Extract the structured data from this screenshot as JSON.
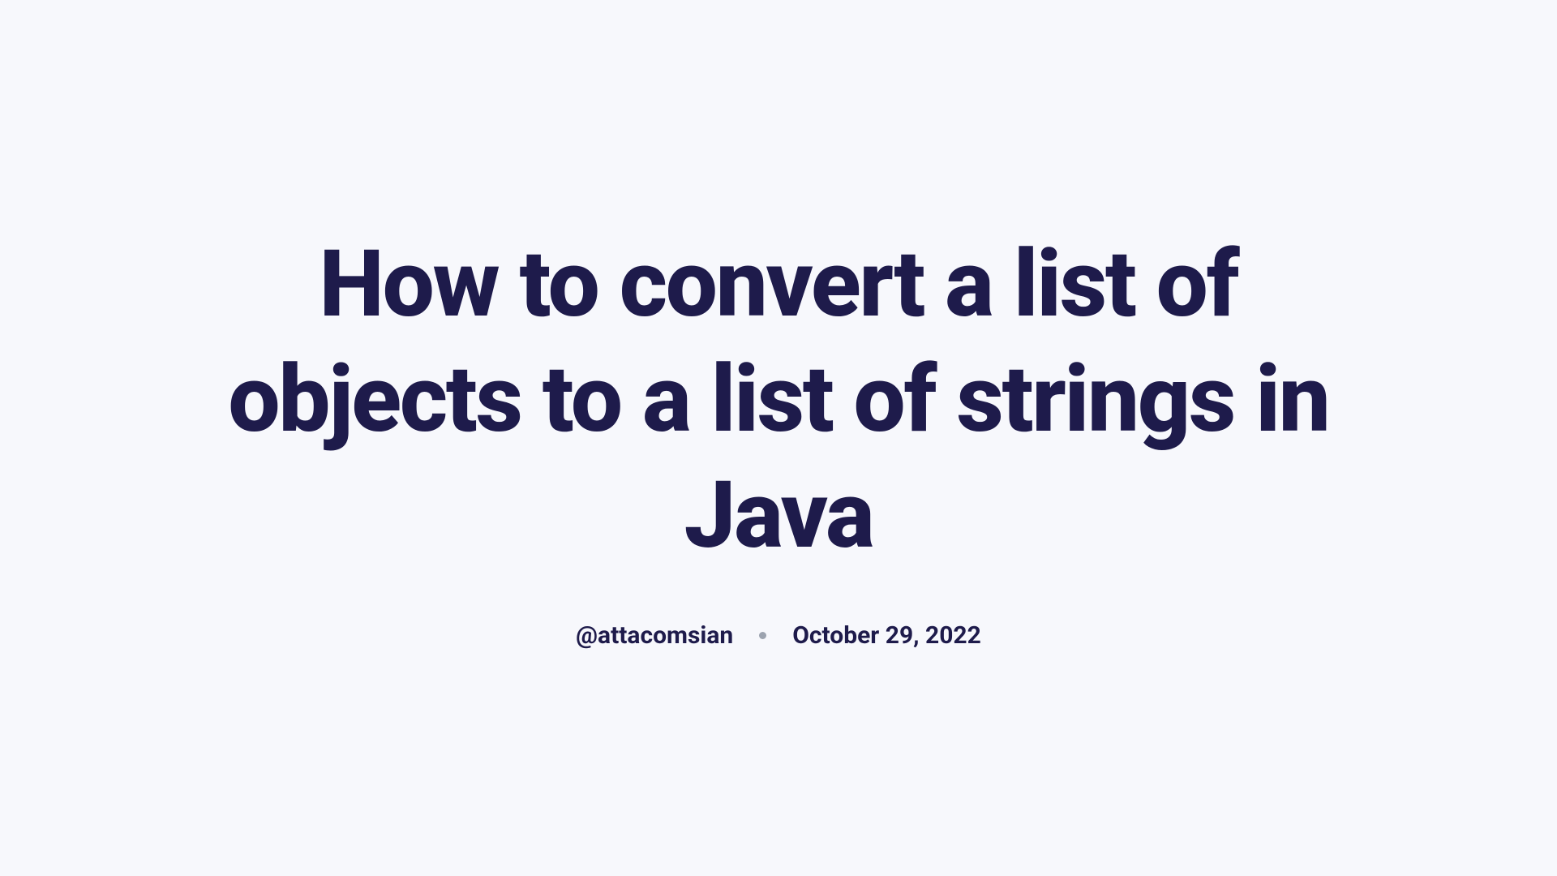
{
  "title": "How to convert a list of objects to a list of strings in Java",
  "author": "@attacomsian",
  "date": "October 29, 2022"
}
